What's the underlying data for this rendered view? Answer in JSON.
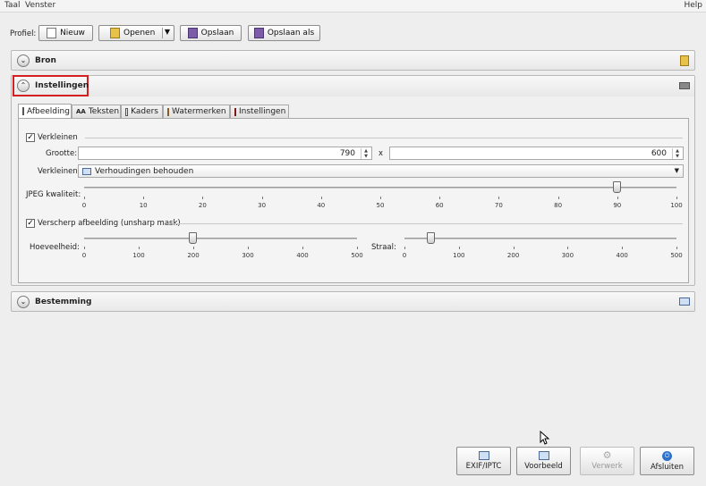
{
  "menu": [
    "Taal",
    "Venster"
  ],
  "help": "Help",
  "toolbar": {
    "profile_label": "Profiel:",
    "new": "Nieuw",
    "open": "Openen",
    "save": "Opslaan",
    "save_as": "Opslaan als"
  },
  "sections": {
    "source": "Bron",
    "settings": "Instellingen",
    "destination": "Bestemming"
  },
  "tabs": [
    {
      "label": "Afbeelding",
      "active": true
    },
    {
      "label": "Teksten",
      "prefix": "AA"
    },
    {
      "label": "Kaders"
    },
    {
      "label": "Watermerken"
    },
    {
      "label": "Instellingen"
    }
  ],
  "resize": {
    "checkbox_label": "Verkleinen",
    "checked": true,
    "size_label": "Grootte:",
    "width": "790",
    "separator": "x",
    "height": "600",
    "mode_label": "Verkleinen:",
    "mode_value": "Verhoudingen behouden"
  },
  "jpeg": {
    "label": "JPEG kwaliteit:",
    "value": 90,
    "min": 0,
    "max": 100,
    "ticks": [
      "0",
      "10",
      "20",
      "30",
      "40",
      "50",
      "60",
      "70",
      "80",
      "90",
      "100"
    ]
  },
  "sharpen": {
    "checkbox_label": "Verscherp afbeelding (unsharp mask)",
    "checked": true,
    "amount_label": "Hoeveelheid:",
    "amount_value": 200,
    "amount_ticks": [
      "0",
      "100",
      "200",
      "300",
      "400",
      "500"
    ],
    "radius_label": "Straal:",
    "radius_value": 50,
    "radius_ticks": [
      "0",
      "100",
      "200",
      "300",
      "400",
      "500"
    ],
    "max": 500
  },
  "bottom": {
    "exif": "EXIF/IPTC",
    "preview": "Voorbeeld",
    "process": "Verwerk",
    "close": "Afsluiten"
  },
  "colors": {
    "highlight": "#d42020"
  }
}
